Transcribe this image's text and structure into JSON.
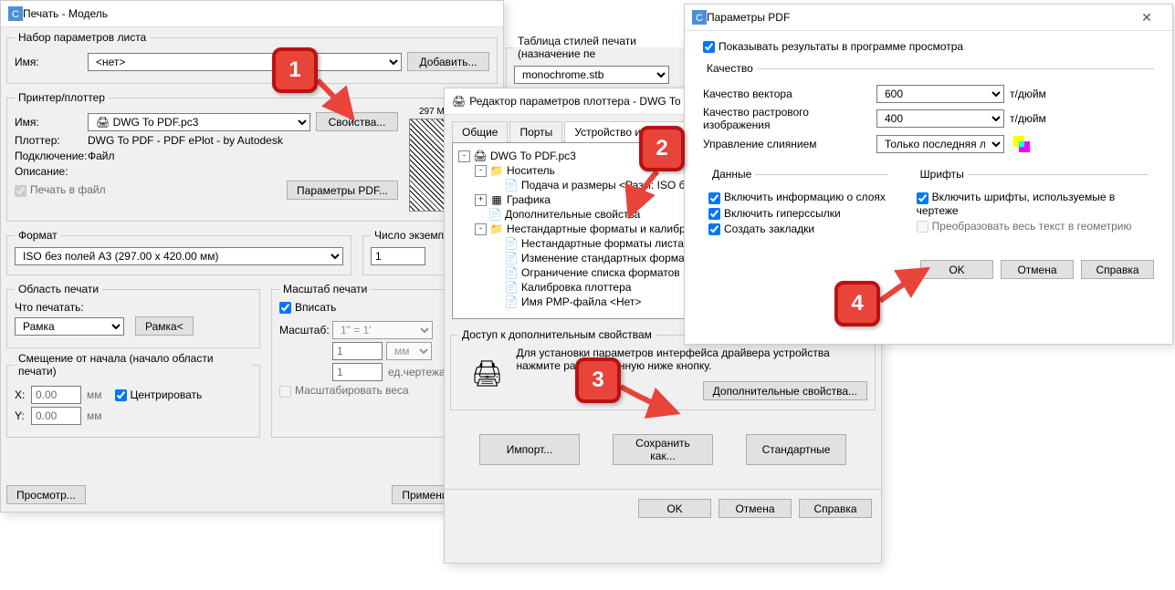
{
  "print": {
    "title": "Печать - Модель",
    "pageSetup": {
      "legend": "Набор параметров листа",
      "nameLabel": "Имя:",
      "nameValue": "<нет>",
      "addBtn": "Добавить..."
    },
    "printer": {
      "legend": "Принтер/плоттер",
      "nameLabel": "Имя:",
      "nameValue": "DWG To PDF.pc3",
      "propsBtn": "Свойства...",
      "plotterLabel": "Плоттер:",
      "plotterValue": "DWG To PDF - PDF ePlot - by Autodesk",
      "connLabel": "Подключение:",
      "connValue": "Файл",
      "descLabel": "Описание:",
      "plotToFile": "Печать в файл",
      "pdfParamsBtn": "Параметры PDF..."
    },
    "format": {
      "legend": "Формат",
      "value": "ISO без полей A3 (297.00 x 420.00 мм)"
    },
    "copies": {
      "legend": "Число экземпляров",
      "value": "1"
    },
    "plotArea": {
      "legend": "Область печати",
      "whatLabel": "Что печатать:",
      "value": "Рамка",
      "windowBtn": "Рамка<"
    },
    "scale": {
      "legend": "Масштаб печати",
      "fit": "Вписать",
      "scaleLabel": "Масштаб:",
      "scaleValue": "1\" = 1'",
      "unit1": "1",
      "unitLabel": "мм",
      "unit2": "1",
      "unit2Label": "ед.чертежа",
      "scaleLw": "Масштабировать веса"
    },
    "offset": {
      "legend": "Смещение от начала (начало области печати)",
      "xLabel": "X:",
      "xValue": "0.00",
      "yLabel": "Y:",
      "yValue": "0.00",
      "unit": "мм",
      "center": "Центрировать"
    },
    "styleTable": {
      "legend": "Таблица стилей печати (назначение пе",
      "value": "monochrome.stb"
    },
    "previewBtn": "Просмотр...",
    "applyBtn": "Применить к лис"
  },
  "editor": {
    "title": "Редактор параметров плоттера - DWG To P",
    "tabs": [
      "Общие",
      "Порты",
      "Устройство и докумен"
    ],
    "tree": [
      {
        "indent": 0,
        "toggle": "-",
        "icon": "plotter",
        "label": "DWG To PDF.pc3"
      },
      {
        "indent": 1,
        "toggle": "-",
        "icon": "folder",
        "label": "Носитель"
      },
      {
        "indent": 2,
        "toggle": "",
        "icon": "page",
        "label": "Подача и размеры <Разм: ISO без п"
      },
      {
        "indent": 1,
        "toggle": "+",
        "icon": "grid",
        "label": "Графика"
      },
      {
        "indent": 1,
        "toggle": "",
        "icon": "page",
        "label": "Дополнительные свойства"
      },
      {
        "indent": 1,
        "toggle": "-",
        "icon": "folder",
        "label": "Нестандартные форматы и калибровка"
      },
      {
        "indent": 2,
        "toggle": "",
        "icon": "page",
        "label": "Нестандартные форматы листа"
      },
      {
        "indent": 2,
        "toggle": "",
        "icon": "page",
        "label": "Изменение стандартных форматов"
      },
      {
        "indent": 2,
        "toggle": "",
        "icon": "page",
        "label": "Ограничение списка форматов"
      },
      {
        "indent": 2,
        "toggle": "",
        "icon": "page",
        "label": "Калибровка плоттера"
      },
      {
        "indent": 2,
        "toggle": "",
        "icon": "page",
        "label": "Имя PMP-файла <Нет>"
      }
    ],
    "access": {
      "legend": "Доступ к дополнительным свойствам",
      "text": "Для установки параметров интерфейса драйвера устройства нажмите расположенную ниже кнопку.",
      "btn": "Дополнительные свойства..."
    },
    "importBtn": "Импорт...",
    "saveAsBtn": "Сохранить как...",
    "defaultsBtn": "Стандартные",
    "okBtn": "OK",
    "cancelBtn": "Отмена",
    "helpBtn": "Справка"
  },
  "pdf": {
    "title": "Параметры PDF",
    "showResults": "Показывать результаты в программе просмотра",
    "quality": {
      "legend": "Качество",
      "vectorLabel": "Качество вектора",
      "vectorValue": "600",
      "rasterLabel": "Качество растрового изображения",
      "rasterValue": "400",
      "unit": "т/дюйм",
      "mergeLabel": "Управление слиянием",
      "mergeValue": "Только последняя линия"
    },
    "data": {
      "legend": "Данные",
      "layers": "Включить информацию о слоях",
      "hyperlinks": "Включить гиперссылки",
      "bookmarks": "Создать закладки"
    },
    "fonts": {
      "legend": "Шрифты",
      "include": "Включить шрифты, используемые в чертеже",
      "convert": "Преобразовать весь текст в геометрию"
    },
    "okBtn": "OK",
    "cancelBtn": "Отмена",
    "helpBtn": "Справка"
  },
  "callouts": [
    "1",
    "2",
    "3",
    "4"
  ]
}
